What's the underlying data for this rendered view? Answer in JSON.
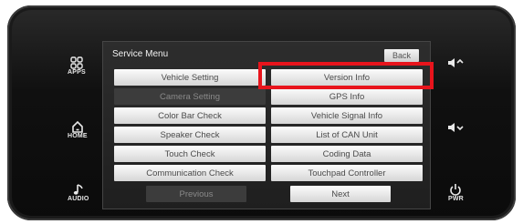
{
  "side_left": {
    "apps_label": "APPS",
    "home_label": "HOME",
    "audio_label": "AUDIO"
  },
  "side_right": {
    "power_label": "PWR"
  },
  "screen": {
    "title": "Service Menu",
    "back_label": "Back",
    "rows": [
      [
        "Vehicle Setting",
        "Version Info"
      ],
      [
        "Camera Setting",
        "GPS Info"
      ],
      [
        "Color Bar Check",
        "Vehicle Signal Info"
      ],
      [
        "Speaker Check",
        "List of CAN Unit"
      ],
      [
        "Touch Check",
        "Coding Data"
      ],
      [
        "Communication Check",
        "Touchpad Controller"
      ]
    ],
    "previous_label": "Previous",
    "next_label": "Next"
  },
  "colors": {
    "highlight": "#e8141c"
  }
}
